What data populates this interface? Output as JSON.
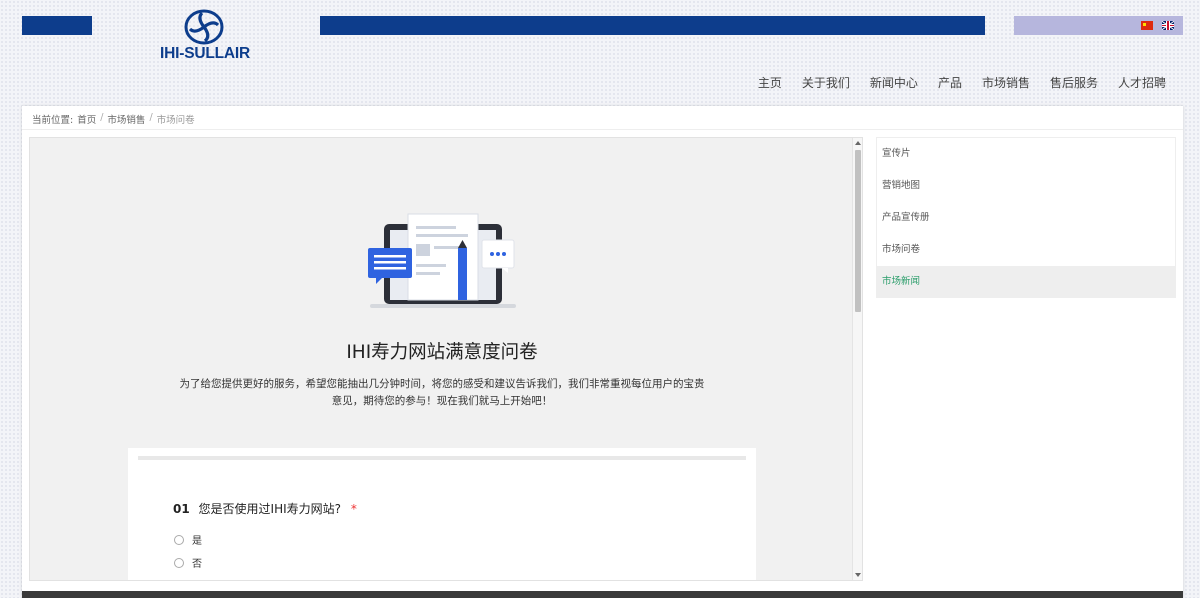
{
  "brand": {
    "logo_text": "IHI-SULLAIR",
    "primary_color": "#0d3d8c"
  },
  "languages": [
    {
      "name": "cn-flag-icon"
    },
    {
      "name": "uk-flag-icon"
    }
  ],
  "nav": {
    "items": [
      "主页",
      "关于我们",
      "新闻中心",
      "产品",
      "市场销售",
      "售后服务",
      "人才招聘"
    ]
  },
  "breadcrumb": {
    "label": "当前位置:",
    "items": [
      "首页",
      "市场销售",
      "市场问卷"
    ],
    "separator": "/"
  },
  "survey": {
    "title": "IHI寿力网站满意度问卷",
    "description": "为了给您提供更好的服务，希望您能抽出几分钟时间，将您的感受和建议告诉我们，我们非常重视每位用户的宝贵意见，期待您的参与！现在我们就马上开始吧！",
    "question": {
      "number": "01",
      "text": "您是否使用过IHI寿力网站?",
      "required_mark": "*",
      "options": [
        "是",
        "否"
      ]
    }
  },
  "sidebar": {
    "items": [
      "宣传片",
      "营销地图",
      "产品宣传册",
      "市场问卷",
      "市场新闻"
    ],
    "active_index": 4,
    "active_color": "#2a9d6a"
  }
}
